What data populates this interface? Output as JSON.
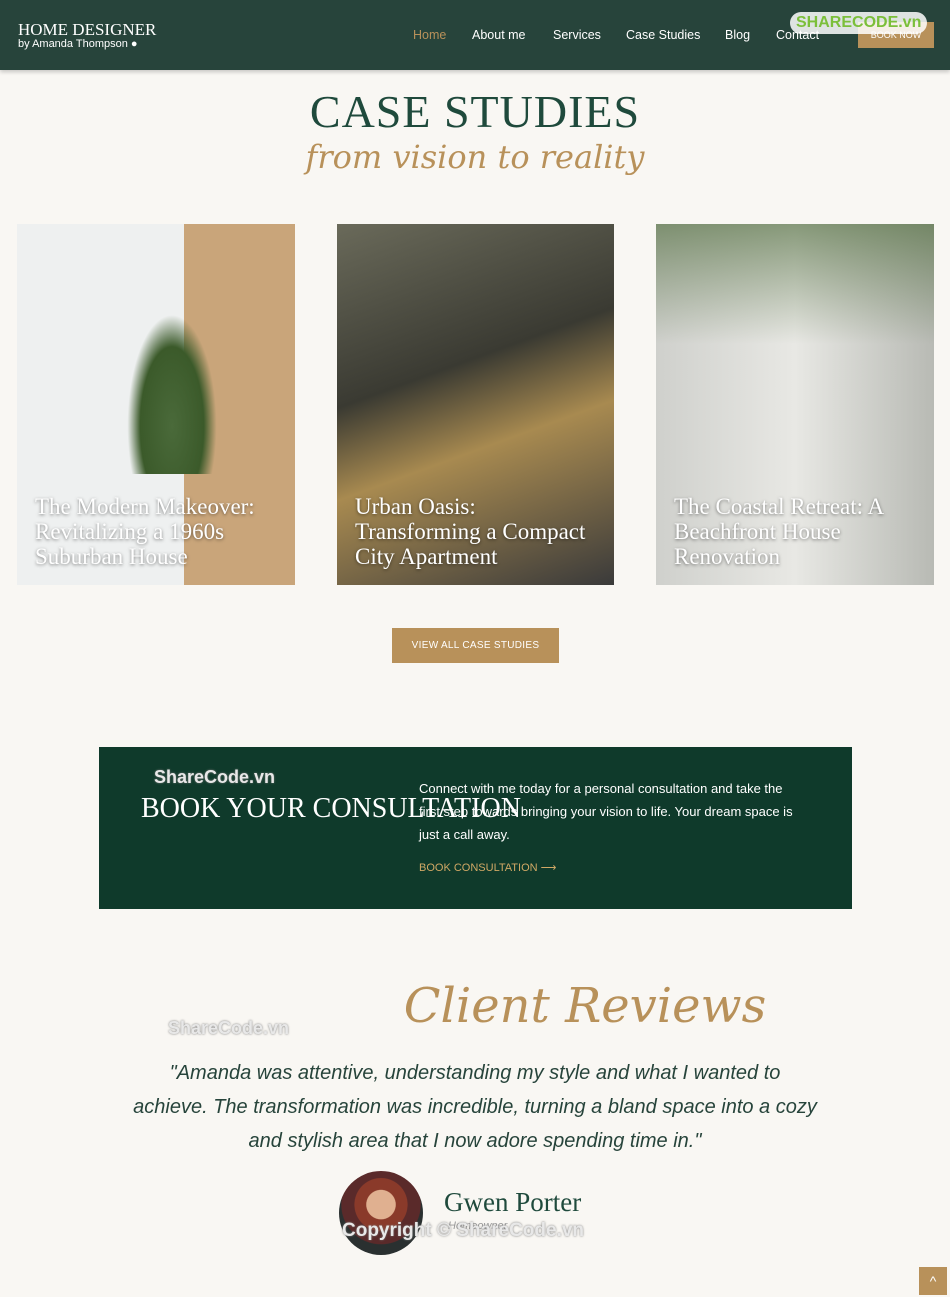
{
  "nav": {
    "logo_title": "HOME DESIGNER",
    "logo_sub": "by Amanda Thompson ●",
    "items": [
      "Home",
      "About me",
      "Services",
      "Case Studies",
      "Blog",
      "Contact"
    ],
    "book": "BOOK NOW",
    "active_color": "#b8915a"
  },
  "hero": {
    "title": "CASE STUDIES",
    "subtitle": "from vision to reality"
  },
  "cases": [
    {
      "title": "The Modern Makeover: Revitalizing a 1960s Suburban House"
    },
    {
      "title": "Urban Oasis: Transforming a Compact City Apartment"
    },
    {
      "title": "The Coastal Retreat: A Beachfront House Renovation"
    }
  ],
  "view_all": "VIEW ALL CASE STUDIES",
  "cta": {
    "title": "BOOK YOUR CONSULTATION",
    "text": "Connect with me today for a personal consultation and take the first step towards bringing your vision to life. Your dream space is just a call away.",
    "link": "BOOK CONSULTATION ⟶"
  },
  "reviews": {
    "heading": "Client Reviews",
    "quote": "\"Amanda was attentive, understanding my style and what I wanted to achieve. The transformation was incredible, turning a bland space into a cozy and stylish area that I now adore spending time in.\"",
    "name": "Gwen Porter",
    "role": "Homeowner"
  },
  "watermarks": {
    "top": "SHARECODE.vn",
    "a": "ShareCode.vn",
    "b": "ShareCode.vn",
    "c": "Copyright © ShareCode.vn"
  },
  "scroll_top": "^"
}
